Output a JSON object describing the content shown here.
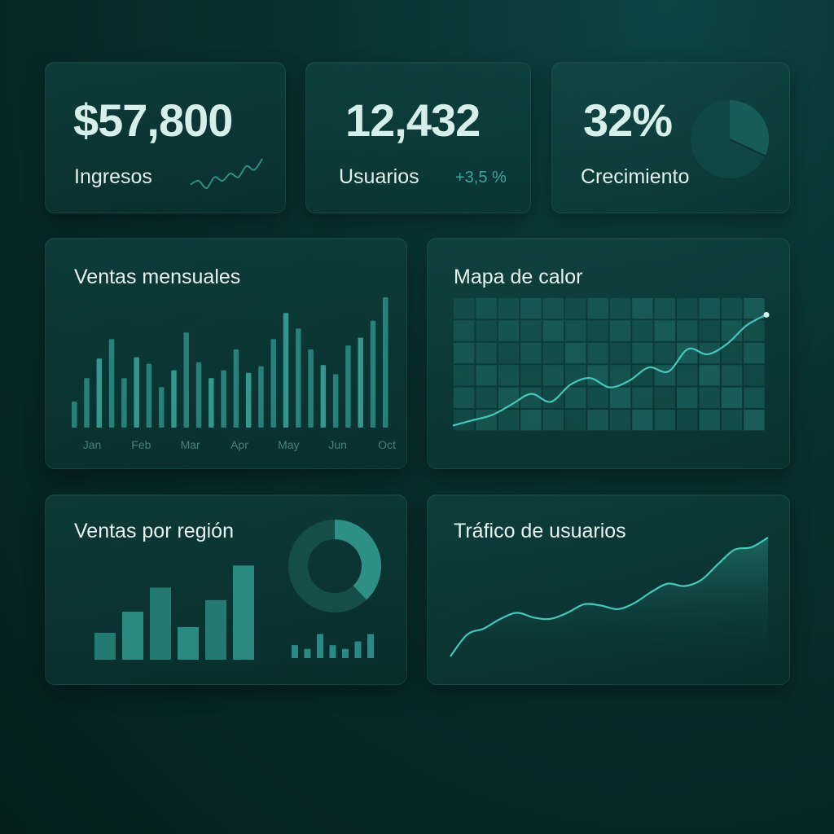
{
  "kpis": {
    "revenue": {
      "value": "$57,800",
      "label": "Ingresos",
      "trend": [
        3,
        4,
        2,
        5,
        4,
        6,
        5,
        8,
        7,
        10
      ]
    },
    "users": {
      "value": "12,432",
      "label": "Usuarios",
      "delta": "+3,5 %"
    },
    "growth": {
      "value": "32%",
      "label": "Crecimiento",
      "pie_fraction": 0.32
    }
  },
  "monthly_sales": {
    "title": "Ventas mensuales",
    "chart_data": {
      "type": "bar",
      "tick_labels": [
        "Jan",
        "Feb",
        "Mar",
        "Apr",
        "May",
        "Jun",
        "Oct"
      ],
      "values": [
        20,
        38,
        53,
        68,
        38,
        54,
        49,
        31,
        44,
        73,
        50,
        38,
        44,
        60,
        42,
        47,
        68,
        88,
        76,
        60,
        48,
        41,
        63,
        69,
        82,
        100
      ]
    }
  },
  "heatmap": {
    "title": "Mapa de calor",
    "chart_data": {
      "type": "heatmap",
      "rows": 6,
      "cols": 14,
      "line": [
        4,
        8,
        12,
        20,
        28,
        22,
        35,
        40,
        33,
        38,
        48,
        45,
        62,
        58,
        66,
        80,
        88
      ]
    }
  },
  "region_sales": {
    "title": "Ventas por región",
    "chart_data": {
      "type": "bar",
      "values": [
        28,
        50,
        75,
        34,
        62,
        98
      ],
      "mini_values": [
        14,
        10,
        26,
        14,
        10,
        18,
        26
      ],
      "donut_fraction": 0.38
    }
  },
  "traffic": {
    "title": "Tráfico de usuarios",
    "chart_data": {
      "type": "area",
      "values": [
        2,
        20,
        25,
        33,
        38,
        34,
        33,
        38,
        45,
        44,
        41,
        46,
        55,
        62,
        60,
        65,
        78,
        90,
        92,
        100
      ]
    }
  },
  "colors": {
    "accent": "#46c7bb",
    "bar": "#2a8a82",
    "bar_light": "#3aa198"
  }
}
